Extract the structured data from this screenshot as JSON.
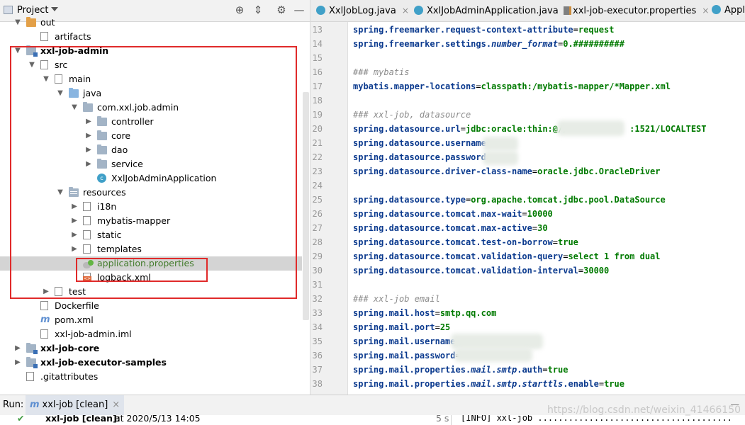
{
  "project_panel": {
    "title": "Project",
    "tree": [
      {
        "label": "out",
        "icon": "folder-orange-icon",
        "arrow": "down",
        "bold": false
      },
      {
        "label": "artifacts",
        "icon": "folder-icon",
        "arrow": "none",
        "bold": false
      },
      {
        "label": "xxl-job-admin",
        "icon": "module-folder-icon",
        "arrow": "down",
        "bold": true
      },
      {
        "label": "src",
        "icon": "folder-icon",
        "arrow": "down",
        "bold": false
      },
      {
        "label": "main",
        "icon": "folder-icon",
        "arrow": "down",
        "bold": false
      },
      {
        "label": "java",
        "icon": "folder-blue-icon",
        "arrow": "down",
        "bold": false
      },
      {
        "label": "com.xxl.job.admin",
        "icon": "package-icon",
        "arrow": "down",
        "bold": false
      },
      {
        "label": "controller",
        "icon": "package-icon",
        "arrow": "right",
        "bold": false
      },
      {
        "label": "core",
        "icon": "package-icon",
        "arrow": "right",
        "bold": false
      },
      {
        "label": "dao",
        "icon": "package-icon",
        "arrow": "right",
        "bold": false
      },
      {
        "label": "service",
        "icon": "package-icon",
        "arrow": "right",
        "bold": false
      },
      {
        "label": "XxlJobAdminApplication",
        "icon": "spring-class-icon",
        "arrow": "none",
        "bold": false
      },
      {
        "label": "resources",
        "icon": "resources-folder-icon",
        "arrow": "down",
        "bold": false
      },
      {
        "label": "i18n",
        "icon": "folder-icon",
        "arrow": "right",
        "bold": false
      },
      {
        "label": "mybatis-mapper",
        "icon": "folder-icon",
        "arrow": "right",
        "bold": false
      },
      {
        "label": "static",
        "icon": "folder-icon",
        "arrow": "right",
        "bold": false
      },
      {
        "label": "templates",
        "icon": "folder-icon",
        "arrow": "right",
        "bold": false
      },
      {
        "label": "application.properties",
        "icon": "spring-properties-icon",
        "arrow": "none",
        "bold": false,
        "selected": true
      },
      {
        "label": "logback.xml",
        "icon": "xml-file-icon",
        "arrow": "none",
        "bold": false
      },
      {
        "label": "test",
        "icon": "folder-icon",
        "arrow": "right",
        "bold": false
      },
      {
        "label": "Dockerfile",
        "icon": "docker-file-icon",
        "arrow": "none",
        "bold": false
      },
      {
        "label": "pom.xml",
        "icon": "maven-icon",
        "arrow": "none",
        "bold": false
      },
      {
        "label": "xxl-job-admin.iml",
        "icon": "iml-file-icon",
        "arrow": "none",
        "bold": false
      },
      {
        "label": "xxl-job-core",
        "icon": "module-folder-icon",
        "arrow": "right",
        "bold": true
      },
      {
        "label": "xxl-job-executor-samples",
        "icon": "module-folder-icon",
        "arrow": "right",
        "bold": true
      },
      {
        "label": ".gitattributes",
        "icon": "file-icon",
        "arrow": "none",
        "bold": false
      }
    ]
  },
  "editor": {
    "tabs": [
      {
        "label": "XxlJobLog.java",
        "icon": "class"
      },
      {
        "label": "XxlJobAdminApplication.java",
        "icon": "class"
      },
      {
        "label": "xxl-job-executor.properties",
        "icon": "prop"
      },
      {
        "label": "Applic",
        "icon": "class"
      }
    ],
    "lines": [
      {
        "n": "13",
        "parts": [
          [
            "k",
            "spring.freemarker.request-context-attribute"
          ],
          [
            "eq",
            "="
          ],
          [
            "v",
            "request"
          ]
        ]
      },
      {
        "n": "14",
        "parts": [
          [
            "k",
            "spring.freemarker.settings."
          ],
          [
            "k it",
            "number_format"
          ],
          [
            "eq",
            "="
          ],
          [
            "v",
            "0.##########"
          ]
        ]
      },
      {
        "n": "15",
        "parts": []
      },
      {
        "n": "16",
        "parts": [
          [
            "cm",
            "### mybatis"
          ]
        ]
      },
      {
        "n": "17",
        "parts": [
          [
            "k",
            "mybatis.mapper-locations"
          ],
          [
            "eq",
            "="
          ],
          [
            "v",
            "classpath:/mybatis-mapper/*Mapper.xml"
          ]
        ]
      },
      {
        "n": "18",
        "parts": []
      },
      {
        "n": "19",
        "parts": [
          [
            "cm",
            "### xxl-job, datasource"
          ]
        ]
      },
      {
        "n": "20",
        "parts": [
          [
            "k",
            "spring.datasource.url"
          ],
          [
            "eq",
            "="
          ],
          [
            "v",
            "jdbc:oracle:thin:@//            :1521/LOCALTEST"
          ]
        ]
      },
      {
        "n": "21",
        "parts": [
          [
            "k",
            "spring.datasource.username"
          ],
          [
            "eq",
            "="
          ]
        ]
      },
      {
        "n": "22",
        "parts": [
          [
            "k",
            "spring.datasource.password"
          ],
          [
            "eq",
            "="
          ]
        ]
      },
      {
        "n": "23",
        "parts": [
          [
            "k",
            "spring.datasource.driver-class-name"
          ],
          [
            "eq",
            "="
          ],
          [
            "v",
            "oracle.jdbc.OracleDriver"
          ]
        ]
      },
      {
        "n": "24",
        "parts": []
      },
      {
        "n": "25",
        "parts": [
          [
            "k",
            "spring.datasource.type"
          ],
          [
            "eq",
            "="
          ],
          [
            "v",
            "org.apache.tomcat.jdbc.pool.DataSource"
          ]
        ]
      },
      {
        "n": "26",
        "parts": [
          [
            "k",
            "spring.datasource.tomcat.max-wait"
          ],
          [
            "eq",
            "="
          ],
          [
            "v",
            "10000"
          ]
        ]
      },
      {
        "n": "27",
        "parts": [
          [
            "k",
            "spring.datasource.tomcat.max-active"
          ],
          [
            "eq",
            "="
          ],
          [
            "v",
            "30"
          ]
        ]
      },
      {
        "n": "28",
        "parts": [
          [
            "k",
            "spring.datasource.tomcat.test-on-borrow"
          ],
          [
            "eq",
            "="
          ],
          [
            "v",
            "true"
          ]
        ]
      },
      {
        "n": "29",
        "parts": [
          [
            "k",
            "spring.datasource.tomcat.validation-query"
          ],
          [
            "eq",
            "="
          ],
          [
            "v",
            "select 1 from dual"
          ]
        ]
      },
      {
        "n": "30",
        "parts": [
          [
            "k",
            "spring.datasource.tomcat.validation-interval"
          ],
          [
            "eq",
            "="
          ],
          [
            "v",
            "30000"
          ]
        ]
      },
      {
        "n": "31",
        "parts": []
      },
      {
        "n": "32",
        "parts": [
          [
            "cm",
            "### xxl-job email"
          ]
        ]
      },
      {
        "n": "33",
        "parts": [
          [
            "k",
            "spring.mail.host"
          ],
          [
            "eq",
            "="
          ],
          [
            "v",
            "smtp.qq.com"
          ]
        ]
      },
      {
        "n": "34",
        "parts": [
          [
            "k",
            "spring.mail.port"
          ],
          [
            "eq",
            "="
          ],
          [
            "v",
            "25"
          ]
        ]
      },
      {
        "n": "35",
        "parts": [
          [
            "k",
            "spring.mail.username"
          ],
          [
            "eq",
            "="
          ]
        ]
      },
      {
        "n": "36",
        "parts": [
          [
            "k",
            "spring.mail.password"
          ],
          [
            "eq",
            "="
          ]
        ]
      },
      {
        "n": "37",
        "parts": [
          [
            "k",
            "spring.mail.properties."
          ],
          [
            "k it",
            "mail"
          ],
          [
            "k",
            "."
          ],
          [
            "k it",
            "smtp"
          ],
          [
            "k",
            ".auth"
          ],
          [
            "eq",
            "="
          ],
          [
            "v",
            "true"
          ]
        ]
      },
      {
        "n": "38",
        "parts": [
          [
            "k",
            "spring.mail.properties."
          ],
          [
            "k it",
            "mail"
          ],
          [
            "k",
            "."
          ],
          [
            "k it",
            "smtp"
          ],
          [
            "k",
            "."
          ],
          [
            "k it",
            "starttls"
          ],
          [
            "k",
            ".enable"
          ],
          [
            "eq",
            "="
          ],
          [
            "v",
            "true"
          ]
        ]
      }
    ]
  },
  "run_bar": {
    "label": "Run:",
    "tab_icon": "m",
    "tab_label": "xxl-job [clean]",
    "tab_close": "×",
    "minimize": "—"
  },
  "status": {
    "check": "✔",
    "job": "xxl-job [clean]:",
    "time": "at 2020/5/13 14:05",
    "duration": "5 s",
    "log": "[INFO] xxl-job ......................................"
  },
  "watermark": "https://blog.csdn.net/weixin_41466150",
  "colors": {
    "highlight_red": "#e02a2a",
    "key_blue": "#0b3a8e",
    "value_green": "#007a00"
  }
}
